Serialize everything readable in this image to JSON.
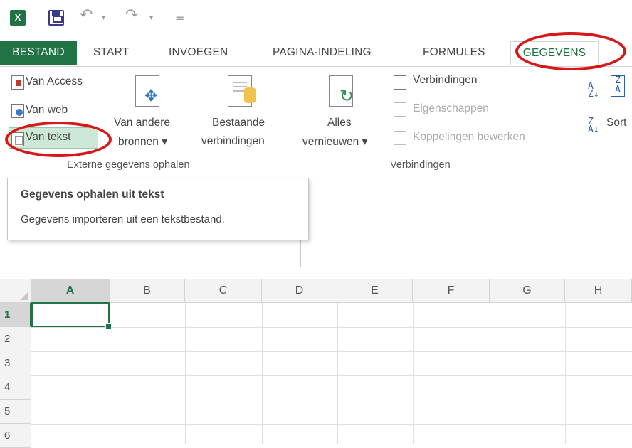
{
  "app": {
    "logo": "X",
    "accent": "#217346"
  },
  "qat": {
    "undo": "↶",
    "redo": "↷",
    "dropdown": "▾",
    "customize": "="
  },
  "tabs": [
    {
      "label": "BESTAND"
    },
    {
      "label": "START"
    },
    {
      "label": "INVOEGEN"
    },
    {
      "label": "PAGINA-INDELING"
    },
    {
      "label": "FORMULES"
    },
    {
      "label": "GEGEVENS"
    }
  ],
  "ribbon": {
    "external": {
      "van_access": "Van Access",
      "van_web": "Van web",
      "van_tekst": "Van tekst",
      "van_andere_line1": "Van andere",
      "van_andere_line2": "bronnen ▾",
      "bestaande_line1": "Bestaande",
      "bestaande_line2": "verbindingen",
      "group_label": "Externe gegevens ophalen"
    },
    "connections": {
      "alles_line1": "Alles",
      "alles_line2": "vernieuwen ▾",
      "verbindingen": "Verbindingen",
      "eigenschappen": "Eigenschappen",
      "koppelingen": "Koppelingen bewerken",
      "group_label": "Verbindingen"
    },
    "sort": {
      "sort_label": "Sort"
    }
  },
  "tooltip": {
    "title": "Gegevens ophalen uit tekst",
    "description": "Gegevens importeren uit een tekstbestand."
  },
  "grid": {
    "columns": [
      "A",
      "B",
      "C",
      "D",
      "E",
      "F",
      "G",
      "H"
    ],
    "rows": [
      "1",
      "2",
      "3",
      "4",
      "5",
      "6"
    ],
    "active_cell": "A1"
  }
}
